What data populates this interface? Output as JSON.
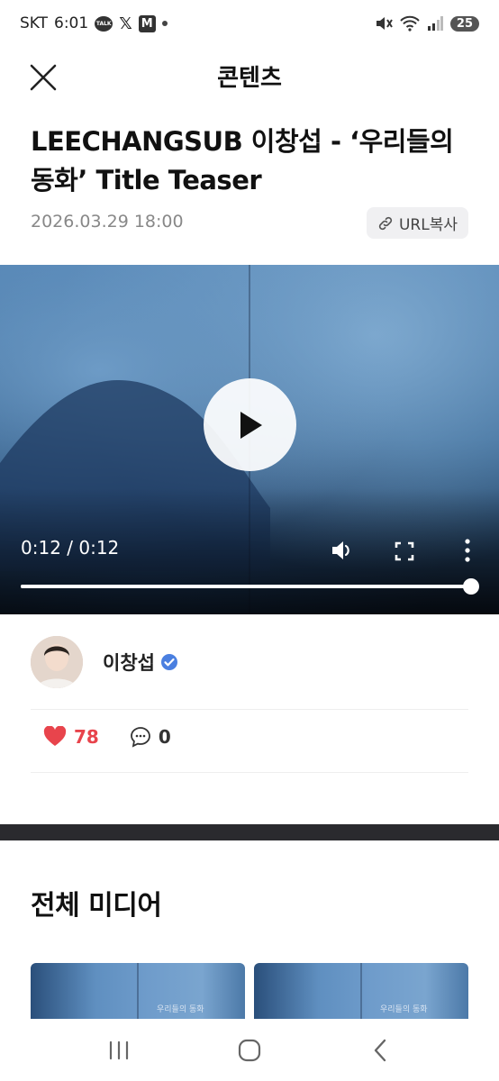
{
  "status_bar": {
    "carrier": "SKT",
    "time": "6:01",
    "notification_talk_label": "TALK",
    "notification_m_label": "M",
    "battery": "25"
  },
  "header": {
    "title": "콘텐츠"
  },
  "post": {
    "title": "LEECHANGSUB 이창섭 - ‘우리들의 동화’ Title Teaser",
    "date": "2026.03.29 18:00",
    "url_copy_label": "URL복사"
  },
  "video": {
    "time": "0:12 / 0:12",
    "progress": 1.0
  },
  "author": {
    "name": "이창섭",
    "verified": true
  },
  "reactions": {
    "likes": "78",
    "comments": "0"
  },
  "media_section": {
    "title": "전체 미디어",
    "thumb_caption": "우리들의 동화"
  },
  "colors": {
    "like_red": "#e8444c",
    "verified_blue": "#4a7fe0",
    "separator": "#2a2a2e"
  }
}
